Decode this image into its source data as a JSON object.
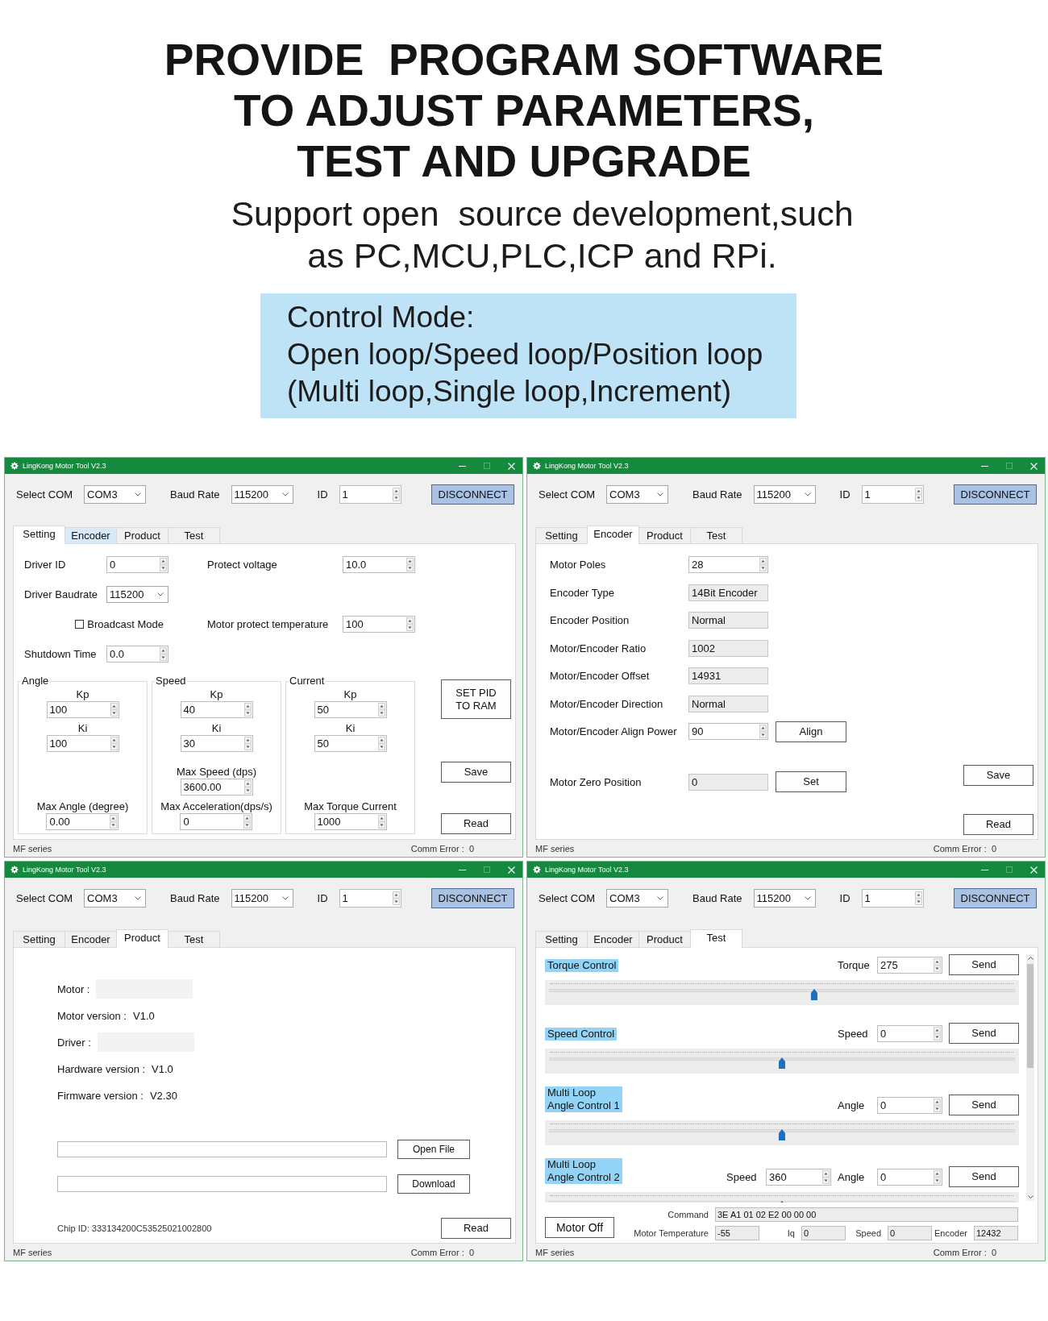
{
  "headline": {
    "lines": [
      "PROVIDE  PROGRAM SOFTWARE",
      "TO ADJUST PARAMETERS,",
      "TEST AND UPGRADE"
    ]
  },
  "subheadline": {
    "lines": [
      "Support open  source development,such",
      "as PC,MCU,PLC,ICP and RPi."
    ]
  },
  "callout": {
    "lines": [
      "Control Mode:",
      "Open loop/Speed loop/Position loop",
      "(Multi loop,Single loop,Increment)"
    ]
  },
  "windows": [
    {
      "title_bar": {
        "title": "LingKong Motor Tool V2.3",
        "maximize_enabled": false
      },
      "connection": {
        "com_label": "Select COM",
        "com": "COM3",
        "baud_label": "Baud Rate",
        "baud": "115200",
        "id_label": "ID",
        "id": "1",
        "button": "DISCONNECT"
      },
      "tabs": [
        {
          "label": "Setting",
          "selected": true,
          "hovered": false
        },
        {
          "label": "Encoder",
          "selected": false,
          "hovered": true
        },
        {
          "label": "Product",
          "selected": false,
          "hovered": false
        },
        {
          "label": "Test",
          "selected": false,
          "hovered": false
        }
      ],
      "page": {
        "kind": "setting",
        "rows": [
          [
            {
              "kind": "spin",
              "label": "Driver ID",
              "value": "0"
            },
            {
              "kind": "spin",
              "label": "Protect voltage",
              "value": "10.0"
            }
          ],
          [
            {
              "kind": "combo",
              "label": "Driver Baudrate",
              "value": "115200"
            }
          ],
          [
            {
              "kind": "checkbox",
              "label": "Broadcast Mode",
              "checked": false
            },
            {
              "kind": "spin",
              "label": "Motor protect temperature",
              "value": "100"
            }
          ],
          [
            {
              "kind": "spin",
              "label": "Shutdown Time",
              "value": "0.0"
            }
          ]
        ],
        "groups": [
          {
            "title": "Angle",
            "params": [
              {
                "label": "Kp",
                "value": "100"
              },
              {
                "label": "Ki",
                "value": "100"
              },
              {
                "label": "Max Angle (degree)",
                "value": "0.00"
              }
            ]
          },
          {
            "title": "Speed",
            "params": [
              {
                "label": "Kp",
                "value": "40"
              },
              {
                "label": "Ki",
                "value": "30"
              },
              {
                "label": "Max Speed (dps)",
                "value": "3600.00"
              },
              {
                "label": "Max Acceleration(dps/s)",
                "value": "0"
              }
            ]
          },
          {
            "title": "Current",
            "params": [
              {
                "label": "Kp",
                "value": "50"
              },
              {
                "label": "Ki",
                "value": "50"
              },
              {
                "label": "Max Torque Current",
                "value": "1000"
              }
            ]
          }
        ],
        "buttons": [
          "SET PID TO RAM",
          "Save",
          "Read"
        ]
      },
      "status_bar": {
        "left": "MF series",
        "right": "Comm Error :  0"
      }
    },
    {
      "title_bar": {
        "title": "LingKong Motor Tool V2.3",
        "maximize_enabled": false
      },
      "connection": {
        "com_label": "Select COM",
        "com": "COM3",
        "baud_label": "Baud Rate",
        "baud": "115200",
        "id_label": "ID",
        "id": "1",
        "button": "DISCONNECT"
      },
      "tabs": [
        {
          "label": "Setting",
          "selected": false,
          "hovered": false
        },
        {
          "label": "Encoder",
          "selected": true,
          "hovered": false
        },
        {
          "label": "Product",
          "selected": false,
          "hovered": false
        },
        {
          "label": "Test",
          "selected": false,
          "hovered": false
        }
      ],
      "page": {
        "kind": "encoder",
        "rows": [
          {
            "kind": "spin",
            "label": "Motor Poles",
            "value": "28"
          },
          {
            "kind": "readonly",
            "label": "Encoder Type",
            "value": "14Bit Encoder"
          },
          {
            "kind": "readonly",
            "label": "Encoder Position",
            "value": "Normal"
          },
          {
            "kind": "readonly",
            "label": "Motor/Encoder Ratio",
            "value": "1002"
          },
          {
            "kind": "readonly",
            "label": "Motor/Encoder Offset",
            "value": "14931"
          },
          {
            "kind": "readonly",
            "label": "Motor/Encoder Direction",
            "value": "Normal"
          },
          {
            "kind": "spin",
            "label": "Motor/Encoder Align Power",
            "value": "90",
            "button": "Align"
          },
          {
            "kind": "readonly",
            "label": "Motor Zero Position",
            "value": "0",
            "button": "Set"
          }
        ],
        "buttons": [
          "Save",
          "Read"
        ]
      },
      "status_bar": {
        "left": "MF series",
        "right": "Comm Error :  0"
      }
    },
    {
      "title_bar": {
        "title": "LingKong Motor Tool V2.3",
        "maximize_enabled": false
      },
      "connection": {
        "com_label": "Select COM",
        "com": "COM3",
        "baud_label": "Baud Rate",
        "baud": "115200",
        "id_label": "ID",
        "id": "1",
        "button": "DISCONNECT"
      },
      "tabs": [
        {
          "label": "Setting",
          "selected": false,
          "hovered": false
        },
        {
          "label": "Encoder",
          "selected": false,
          "hovered": false
        },
        {
          "label": "Product",
          "selected": true,
          "hovered": false
        },
        {
          "label": "Test",
          "selected": false,
          "hovered": false
        }
      ],
      "page": {
        "kind": "product",
        "info": [
          {
            "kind": "blank",
            "label": "Motor :"
          },
          {
            "kind": "text",
            "label": "Motor version :",
            "value": "V1.0"
          },
          {
            "kind": "blank",
            "label": "Driver :"
          },
          {
            "kind": "text",
            "label": "Hardware version :",
            "value": "V1.0"
          },
          {
            "kind": "text",
            "label": "Firmware version :",
            "value": "V2.30"
          }
        ],
        "file_buttons": [
          "Open File",
          "Download"
        ],
        "chip_id": "Chip ID: 333134200C53525021002800",
        "read_button": "Read"
      },
      "status_bar": {
        "left": "MF series",
        "right": "Comm Error :  0"
      }
    },
    {
      "title_bar": {
        "title": "LingKong Motor Tool V2.3",
        "maximize_enabled": false
      },
      "connection": {
        "com_label": "Select COM",
        "com": "COM3",
        "baud_label": "Baud Rate",
        "baud": "115200",
        "id_label": "ID",
        "id": "1",
        "button": "DISCONNECT"
      },
      "tabs": [
        {
          "label": "Setting",
          "selected": false,
          "hovered": false
        },
        {
          "label": "Encoder",
          "selected": false,
          "hovered": false
        },
        {
          "label": "Product",
          "selected": false,
          "hovered": false
        },
        {
          "label": "Test",
          "selected": true,
          "hovered": false
        }
      ],
      "page": {
        "kind": "test",
        "controls": [
          {
            "title": "Torque Control",
            "inputs": [
              {
                "label": "Torque",
                "value": "275"
              }
            ],
            "button": "Send",
            "level": 0.57
          },
          {
            "title": "Speed Control",
            "inputs": [
              {
                "label": "Speed",
                "value": "0"
              }
            ],
            "button": "Send",
            "level": 0.5
          },
          {
            "title": "Multi Loop\nAngle Control 1",
            "inputs": [
              {
                "label": "Angle",
                "value": "0"
              }
            ],
            "button": "Send",
            "level": 0.5
          },
          {
            "title": "Multi Loop\nAngle Control 2",
            "inputs": [
              {
                "label": "Speed",
                "value": "360"
              },
              {
                "label": "Angle",
                "value": "0"
              }
            ],
            "button": "Send",
            "level": 0.5
          }
        ],
        "motor_off_button": "Motor Off",
        "readouts": [
          {
            "label": "Command",
            "value": "3E A1 01 02 E2 00 00 00"
          },
          {
            "label": "Motor Temperature",
            "value": "-55"
          },
          {
            "label": "Iq",
            "value": "0"
          },
          {
            "label": "Speed",
            "value": "0"
          },
          {
            "label": "Encoder",
            "value": "12432"
          }
        ]
      },
      "status_bar": {
        "left": "MF series",
        "right": "Comm Error :  0"
      }
    }
  ]
}
